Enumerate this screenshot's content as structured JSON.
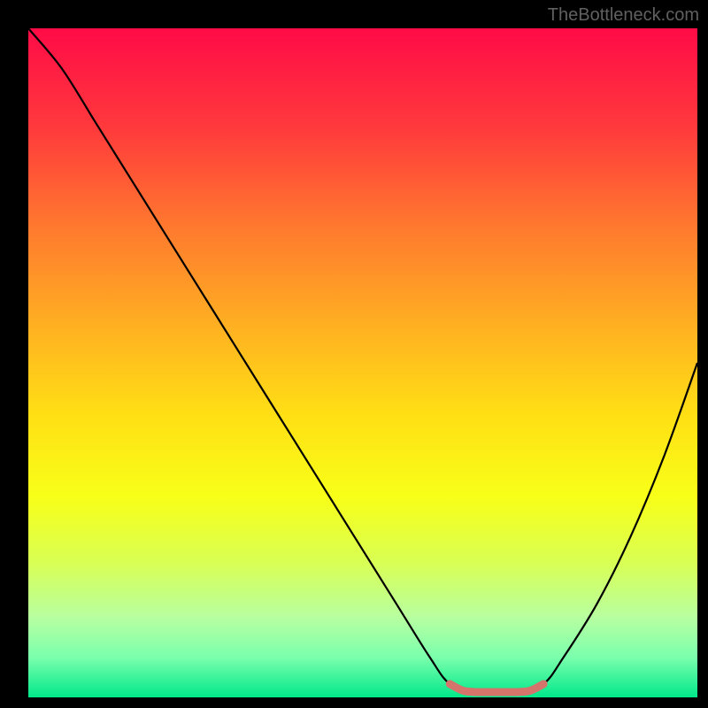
{
  "watermark": "TheBottleneck.com",
  "chart_data": {
    "type": "line",
    "title": "",
    "xlabel": "",
    "ylabel": "",
    "xlim": [
      0,
      100
    ],
    "ylim": [
      0,
      100
    ],
    "series": [
      {
        "name": "bottleneck-curve",
        "x": [
          0,
          5,
          10,
          15,
          20,
          25,
          30,
          35,
          40,
          45,
          50,
          55,
          60,
          63,
          67,
          70,
          73,
          77,
          80,
          85,
          90,
          95,
          100
        ],
        "y": [
          100,
          94,
          86,
          78,
          70,
          62,
          54,
          46,
          38,
          30,
          22,
          14,
          6,
          2,
          0.5,
          0.5,
          0.5,
          2,
          6,
          14,
          24,
          36,
          50
        ]
      },
      {
        "name": "optimal-band",
        "x": [
          63,
          65,
          67,
          69,
          71,
          73,
          75,
          77
        ],
        "y": [
          2,
          1,
          0.8,
          0.8,
          0.8,
          0.8,
          1,
          2
        ]
      }
    ],
    "gradient_stops": [
      {
        "pos": 0.0,
        "color": "#ff0b47"
      },
      {
        "pos": 0.15,
        "color": "#ff3a3c"
      },
      {
        "pos": 0.3,
        "color": "#ff7a2e"
      },
      {
        "pos": 0.45,
        "color": "#ffb221"
      },
      {
        "pos": 0.58,
        "color": "#ffe014"
      },
      {
        "pos": 0.7,
        "color": "#f8ff18"
      },
      {
        "pos": 0.8,
        "color": "#d8ff55"
      },
      {
        "pos": 0.88,
        "color": "#b8ffa0"
      },
      {
        "pos": 0.94,
        "color": "#7bffad"
      },
      {
        "pos": 1.0,
        "color": "#00e88a"
      }
    ],
    "optimal_band_color": "#d4746b"
  }
}
